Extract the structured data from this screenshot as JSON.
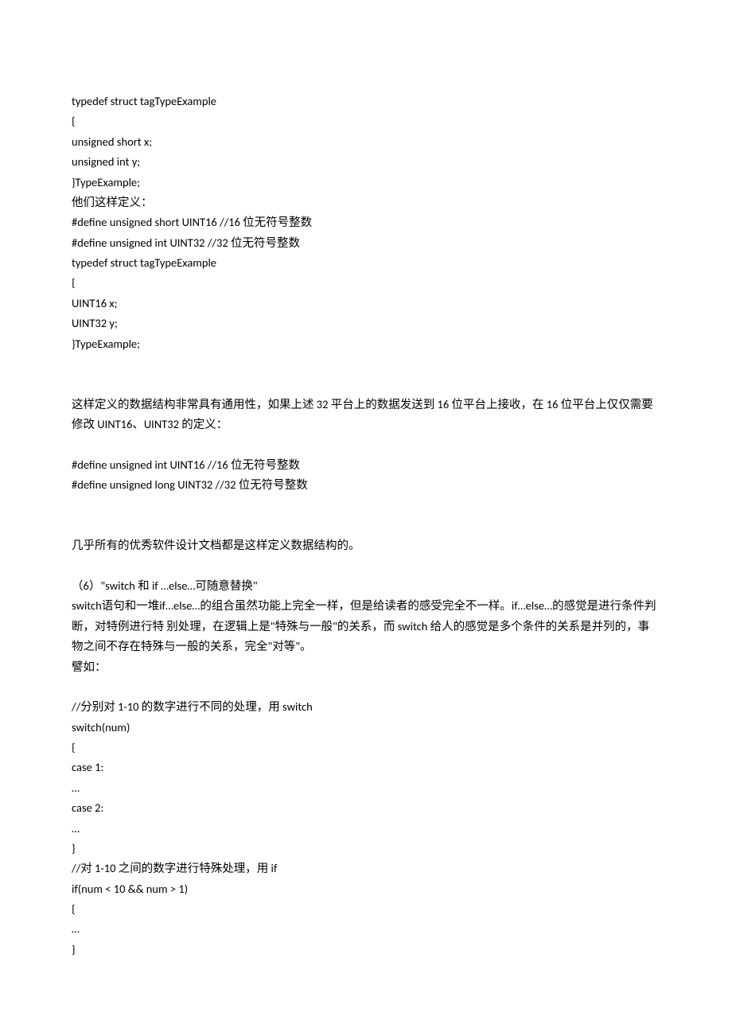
{
  "lines": [
    "typedef struct tagTypeExample",
    "{",
    "unsigned short x;",
    "unsigned int y;",
    "}TypeExample;",
    "他们这样定义：",
    "#define unsigned short UINT16 //16 位无符号整数",
    "#define unsigned int UINT32 //32 位无符号整数",
    "typedef struct tagTypeExample",
    "{",
    "UINT16 x;",
    "UINT32 y;",
    "}TypeExample;",
    "",
    "",
    "这样定义的数据结构非常具有通用性，如果上述 32 平台上的数据发送到 16 位平台上接收，在 16 位平台上仅仅需要修改 UINT16、UINT32 的定义：",
    "",
    "#define unsigned int UINT16 //16 位无符号整数",
    "#define unsigned long UINT32 //32 位无符号整数",
    "",
    "",
    "几乎所有的优秀软件设计文档都是这样定义数据结构的。",
    "",
    "（6）\"switch 和 if …else…可随意替换\"",
    "switch语句和一堆if…else…的组合虽然功能上完全一样，但是给读者的感受完全不一样。if…else…的感觉是进行条件判断，对特例进行特 别处理，在逻辑上是\"特殊与一般\"的关系，而 switch 给人的感觉是多个条件的关系是并列的，事物之间不存在特殊与一般的关系，完全\"对等\"。",
    "譬如：",
    "",
    "//分别对 1-10 的数字进行不同的处理，用 switch",
    "switch(num)",
    "{",
    "case 1:",
    "…",
    "case 2:",
    "…",
    "}",
    "//对 1-10 之间的数字进行特殊处理，用 if",
    "if(num < 10 && num > 1)",
    "{",
    "…",
    "}"
  ]
}
